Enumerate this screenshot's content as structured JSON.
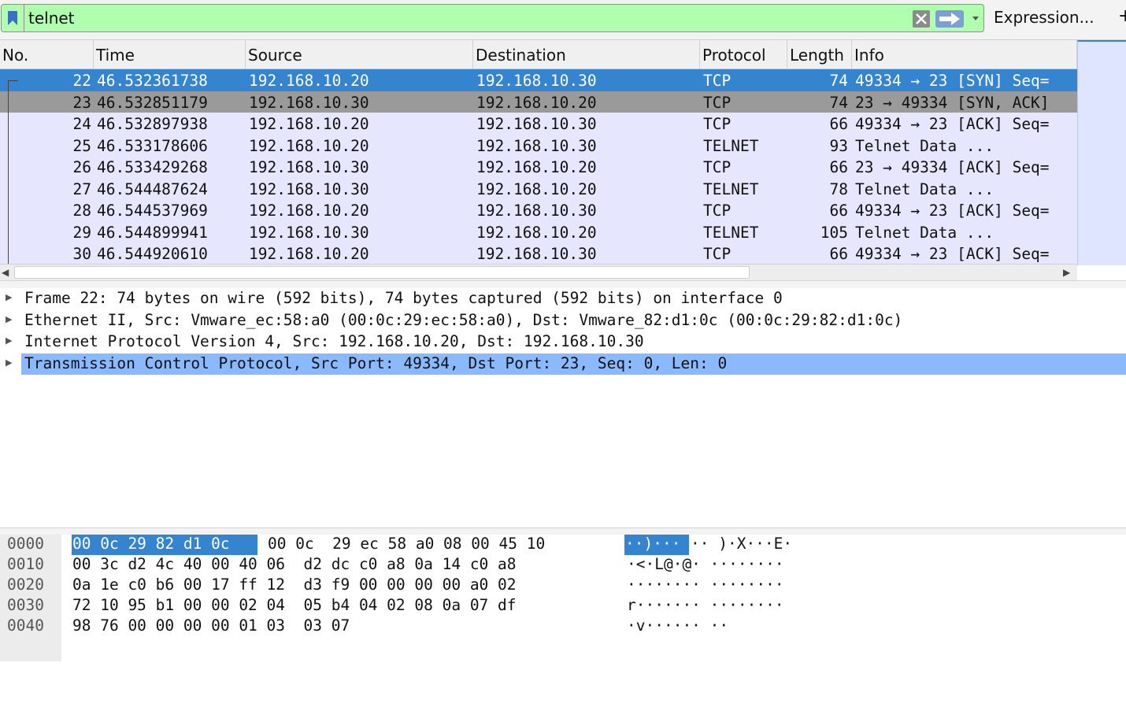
{
  "filter_bar": {
    "value": "telnet",
    "expression_label": "Expression...",
    "plus_label": "+"
  },
  "packet_list": {
    "columns": [
      "No.",
      "Time",
      "Source",
      "Destination",
      "Protocol",
      "Length",
      "Info"
    ],
    "rows": [
      {
        "no": "22",
        "time": "46.532361738",
        "source": "192.168.10.20",
        "destination": "192.168.10.30",
        "protocol": "TCP",
        "length": "74",
        "info": "49334 → 23 [SYN] Seq="
      },
      {
        "no": "23",
        "time": "46.532851179",
        "source": "192.168.10.30",
        "destination": "192.168.10.20",
        "protocol": "TCP",
        "length": "74",
        "info": "23 → 49334 [SYN, ACK]"
      },
      {
        "no": "24",
        "time": "46.532897938",
        "source": "192.168.10.20",
        "destination": "192.168.10.30",
        "protocol": "TCP",
        "length": "66",
        "info": "49334 → 23 [ACK] Seq="
      },
      {
        "no": "25",
        "time": "46.533178606",
        "source": "192.168.10.20",
        "destination": "192.168.10.30",
        "protocol": "TELNET",
        "length": "93",
        "info": "Telnet Data ..."
      },
      {
        "no": "26",
        "time": "46.533429268",
        "source": "192.168.10.30",
        "destination": "192.168.10.20",
        "protocol": "TCP",
        "length": "66",
        "info": "23 → 49334 [ACK] Seq="
      },
      {
        "no": "27",
        "time": "46.544487624",
        "source": "192.168.10.30",
        "destination": "192.168.10.20",
        "protocol": "TELNET",
        "length": "78",
        "info": "Telnet Data ..."
      },
      {
        "no": "28",
        "time": "46.544537969",
        "source": "192.168.10.20",
        "destination": "192.168.10.30",
        "protocol": "TCP",
        "length": "66",
        "info": "49334 → 23 [ACK] Seq="
      },
      {
        "no": "29",
        "time": "46.544899941",
        "source": "192.168.10.30",
        "destination": "192.168.10.20",
        "protocol": "TELNET",
        "length": "105",
        "info": "Telnet Data ..."
      },
      {
        "no": "30",
        "time": "46.544920610",
        "source": "192.168.10.20",
        "destination": "192.168.10.30",
        "protocol": "TCP",
        "length": "66",
        "info": "49334 → 23 [ACK] Seq="
      }
    ]
  },
  "details": [
    "Frame 22: 74 bytes on wire (592 bits), 74 bytes captured (592 bits) on interface 0",
    "Ethernet II, Src: Vmware_ec:58:a0 (00:0c:29:ec:58:a0), Dst: Vmware_82:d1:0c (00:0c:29:82:d1:0c)",
    "Internet Protocol Version 4, Src: 192.168.10.20, Dst: 192.168.10.30",
    "Transmission Control Protocol, Src Port: 49334, Dst Port: 23, Seq: 0, Len: 0"
  ],
  "bytes": [
    {
      "offset": "0000",
      "hex_hl": "00 0c 29 82 d1 0c",
      "hex_rest": "00 0c  29 ec 58 a0 08 00 45 10",
      "asc_hl": "··)···",
      "asc_rest": "·· )·X···E·"
    },
    {
      "offset": "0010",
      "hex_hl": "",
      "hex_rest": "00 3c d2 4c 40 00 40 06  d2 dc c0 a8 0a 14 c0 a8",
      "asc_hl": "",
      "asc_rest": "·<·L@·@· ········"
    },
    {
      "offset": "0020",
      "hex_hl": "",
      "hex_rest": "0a 1e c0 b6 00 17 ff 12  d3 f9 00 00 00 00 a0 02",
      "asc_hl": "",
      "asc_rest": "········ ········"
    },
    {
      "offset": "0030",
      "hex_hl": "",
      "hex_rest": "72 10 95 b1 00 00 02 04  05 b4 04 02 08 0a 07 df",
      "asc_hl": "",
      "asc_rest": "r······· ········"
    },
    {
      "offset": "0040",
      "hex_hl": "",
      "hex_rest": "98 76 00 00 00 00 01 03  03 07",
      "asc_hl": "",
      "asc_rest": "·v······ ··"
    }
  ],
  "colors": {
    "filter_valid": "#afffaf",
    "selected_row": "#3484d0",
    "related_row": "#9a9a9a",
    "tcp_row": "#e7e6ff",
    "detail_highlight": "#8ab9ff"
  }
}
